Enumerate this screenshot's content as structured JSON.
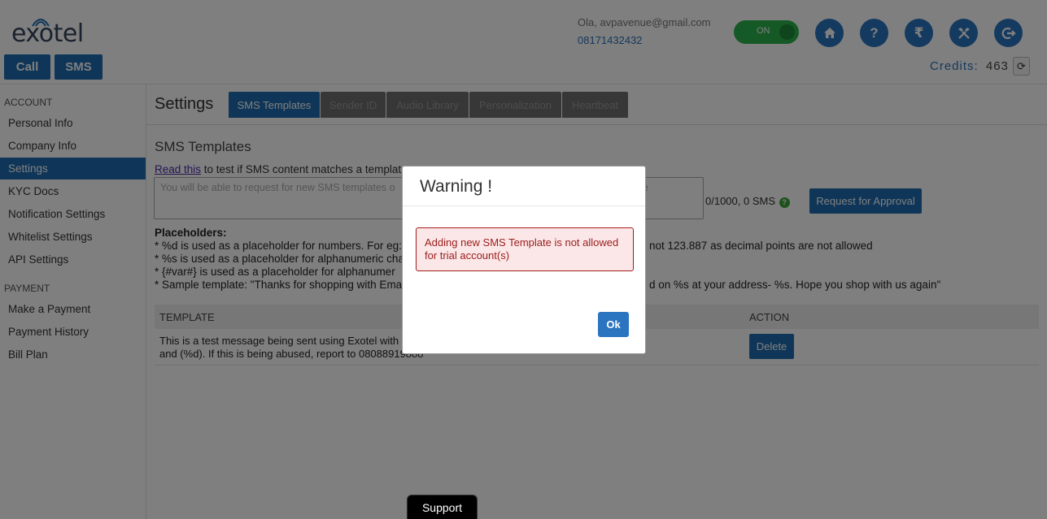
{
  "header": {
    "logo_text": "exotel",
    "call_label": "Call",
    "sms_label": "SMS",
    "user_email": "Ola, avpavenue@gmail.com",
    "user_phone": "08171432432",
    "toggle_label": "ON",
    "icons": [
      "home-icon",
      "help-icon",
      "rupee-icon",
      "tools-icon",
      "logout-icon"
    ],
    "credits_label": "Credits:",
    "credits_value": "463"
  },
  "sidebar": {
    "account_heading": "ACCOUNT",
    "account_items": [
      "Personal Info",
      "Company Info",
      "Settings",
      "KYC Docs",
      "Notification Settings",
      "Whitelist Settings",
      "API Settings"
    ],
    "payment_heading": "PAYMENT",
    "payment_items": [
      "Make a Payment",
      "Payment History",
      "Bill Plan"
    ],
    "active_item": "Settings"
  },
  "main": {
    "title": "Settings",
    "tabs": [
      "SMS Templates",
      "Sender ID",
      "Audio Library",
      "Personalization",
      "Heartbeat"
    ],
    "active_tab": "SMS Templates",
    "section_title": "SMS Templates",
    "read_link": "Read this",
    "read_text": " to test if SMS content matches a templat",
    "textarea_placeholder": "You will be able to request for new SMS templates o",
    "textarea_tail": "e",
    "sms_count": "0/1000, 0 SMS",
    "approval_label": "Request for Approval",
    "placeholders_title": "Placeholders:",
    "placeholder_lines": [
      "* %d is used as a placeholder for numbers. For eg:",
      "* %s is used as a placeholder for alphanumeric cha",
      "* {#var#} is used as a placeholder for alphanumer",
      "* Sample template: \"Thanks for shopping with Ema"
    ],
    "placeholder_tails": [
      "not 123.887 as decimal points are not allowed",
      "",
      "",
      "d on %s at your address- %s. Hope you shop with us again\""
    ],
    "table": {
      "col_template": "TEMPLATE",
      "col_action": "ACTION",
      "row_text_1": "This is a test message being sent using Exotel with",
      "row_text_2": "and (%d). If this is being abused, report to 08088919888",
      "delete_label": "Delete"
    }
  },
  "modal": {
    "title": "Warning !",
    "alert_text": "Adding new SMS Template is not allowed for trial account(s)",
    "ok_label": "Ok"
  },
  "support_label": "Support",
  "colors": {
    "primary": "#1f6cb0",
    "toggle_on": "#2bb24c",
    "alert_border": "#a51c1c",
    "alert_bg": "#fbe7e7"
  }
}
